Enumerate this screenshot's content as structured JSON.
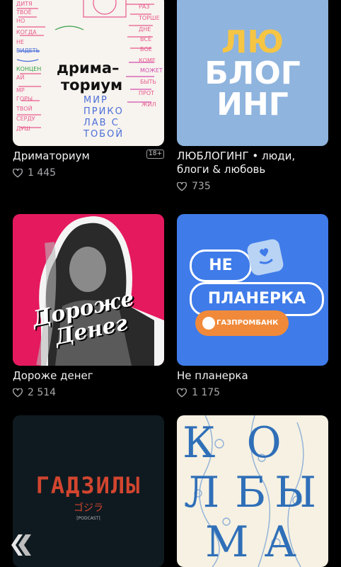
{
  "podcasts": [
    {
      "title": "Дриматориум",
      "likes": "1 445",
      "age_badge": "18+",
      "cover_text_1": "дрима–",
      "cover_text_2": "ториум",
      "cover_note": "МИР ПРИКО ЛАВ С ТОБОЙ"
    },
    {
      "title": "ЛЮБЛОГИНГ • люди, блоги & любовь",
      "likes": "735",
      "cover_lines": [
        "ЛЮ",
        "БЛОГ",
        "ИНГ"
      ]
    },
    {
      "title": "Дороже денег",
      "likes": "2 514",
      "cover_lines": [
        "Дороже",
        "Денег"
      ]
    },
    {
      "title": "Не планерка",
      "likes": "1 175",
      "cover_line_1": "НЕ",
      "cover_line_2": "ПЛАНЕРКА",
      "cover_bank": "ГАЗПРОМБАНК"
    },
    {
      "title": "",
      "likes": "",
      "cover_main": "ГАДЗИЛЫ",
      "cover_sub": "ゴジラ",
      "cover_small": "[PODCAST]"
    },
    {
      "title": "",
      "likes": "",
      "cover_letters": [
        "К",
        "О",
        "Л",
        "Б",
        "Ы",
        "М",
        "А"
      ]
    }
  ],
  "colors": {
    "bg": "#000000",
    "muted": "#a9a9ad",
    "blue_cover": "#8fb4de",
    "pink_cover": "#e5195e",
    "planerka_bg": "#3f7be9",
    "kolyma_bg": "#f6f1e2"
  },
  "icons": [
    "heart-icon",
    "app-logo-icon"
  ]
}
